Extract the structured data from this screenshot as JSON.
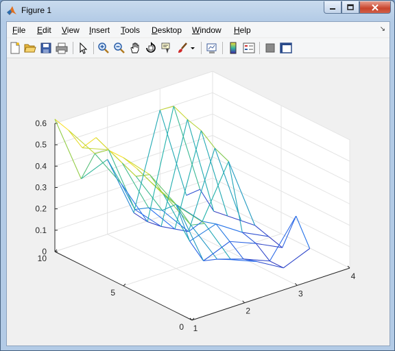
{
  "window": {
    "title": "Figure 1"
  },
  "menu": {
    "items": [
      {
        "label": "File",
        "accel": "F",
        "rest": "ile"
      },
      {
        "label": "Edit",
        "accel": "E",
        "rest": "dit"
      },
      {
        "label": "View",
        "accel": "V",
        "rest": "iew"
      },
      {
        "label": "Insert",
        "accel": "I",
        "rest": "nsert"
      },
      {
        "label": "Tools",
        "accel": "T",
        "rest": "ools"
      },
      {
        "label": "Desktop",
        "accel": "D",
        "rest": "esktop"
      },
      {
        "label": "Window",
        "accel": "W",
        "rest": "indow"
      },
      {
        "label": "Help",
        "accel": "H",
        "rest": "elp"
      }
    ]
  },
  "toolbar": {
    "icons": [
      "new-figure-icon",
      "open-file-icon",
      "save-icon",
      "print-icon",
      "pointer-icon",
      "zoom-in-icon",
      "zoom-out-icon",
      "pan-icon",
      "rotate-3d-icon",
      "data-cursor-icon",
      "brush-icon",
      "dropdown-arrow-icon",
      "link-plot-icon",
      "colorbar-icon",
      "legend-icon",
      "hide-plot-tools-icon",
      "show-plot-tools-icon"
    ]
  },
  "chart_data": {
    "type": "3d-line-mesh",
    "title": "",
    "xlabel": "",
    "ylabel": "",
    "zlabel": "",
    "xlim": [
      1,
      4
    ],
    "ylim": [
      0,
      10
    ],
    "zlim": [
      0,
      0.6
    ],
    "x_ticks": [
      "1",
      "2",
      "3",
      "4"
    ],
    "y_ticks": [
      "0",
      "5",
      "10"
    ],
    "z_ticks": [
      "0",
      "0.1",
      "0.2",
      "0.3",
      "0.4",
      "0.5",
      "0.6"
    ],
    "grid": true,
    "colormap": "parula",
    "series": [
      {
        "x": 1,
        "points": [
          [
            1,
            0.5
          ],
          [
            2,
            0.52
          ],
          [
            3,
            0.55
          ],
          [
            4,
            0.58
          ],
          [
            5,
            0.6
          ],
          [
            6,
            0.6
          ],
          [
            7,
            0.63
          ],
          [
            8,
            0.55
          ],
          [
            9,
            0.6
          ],
          [
            10,
            0.62
          ]
        ]
      },
      {
        "x": 1.5,
        "points": [
          [
            1,
            0.38
          ],
          [
            2,
            0.34
          ],
          [
            3,
            0.4
          ],
          [
            4,
            0.42
          ],
          [
            5,
            0.48
          ],
          [
            6,
            0.44
          ],
          [
            7,
            0.47
          ],
          [
            8,
            0.5
          ],
          [
            9,
            0.45
          ],
          [
            10,
            0.3
          ]
        ]
      },
      {
        "x": 2,
        "points": [
          [
            1,
            0.17
          ],
          [
            2,
            0.14
          ],
          [
            3,
            0.1
          ],
          [
            4,
            0.16
          ],
          [
            5,
            0.3
          ],
          [
            6,
            0.24
          ],
          [
            7,
            0.22
          ],
          [
            8,
            0.18
          ],
          [
            9,
            0.27
          ],
          [
            10,
            0.35
          ]
        ]
      },
      {
        "x": 2.5,
        "points": [
          [
            1,
            0.12
          ],
          [
            2,
            0.1
          ],
          [
            3,
            0.15
          ],
          [
            4,
            0.2
          ],
          [
            5,
            0.18
          ],
          [
            6,
            0.1
          ],
          [
            7,
            0.08
          ],
          [
            8,
            0.06
          ],
          [
            9,
            0.05
          ],
          [
            10,
            0.06
          ]
        ]
      },
      {
        "x": 3,
        "points": [
          [
            1,
            0.05
          ],
          [
            2,
            0.05
          ],
          [
            3,
            0.1
          ],
          [
            4,
            0.12
          ],
          [
            5,
            0.42
          ],
          [
            6,
            0.45
          ],
          [
            7,
            0.5
          ],
          [
            8,
            0.52
          ],
          [
            9,
            0.55
          ],
          [
            10,
            0.5
          ]
        ]
      },
      {
        "x": 3.5,
        "points": [
          [
            1,
            0.1
          ],
          [
            2,
            0.22
          ],
          [
            3,
            0.04
          ],
          [
            4,
            0.06
          ],
          [
            5,
            0.08
          ],
          [
            6,
            0.07
          ],
          [
            7,
            0.06
          ],
          [
            8,
            0.05
          ],
          [
            9,
            0.12
          ],
          [
            10,
            0.06
          ]
        ]
      }
    ]
  }
}
